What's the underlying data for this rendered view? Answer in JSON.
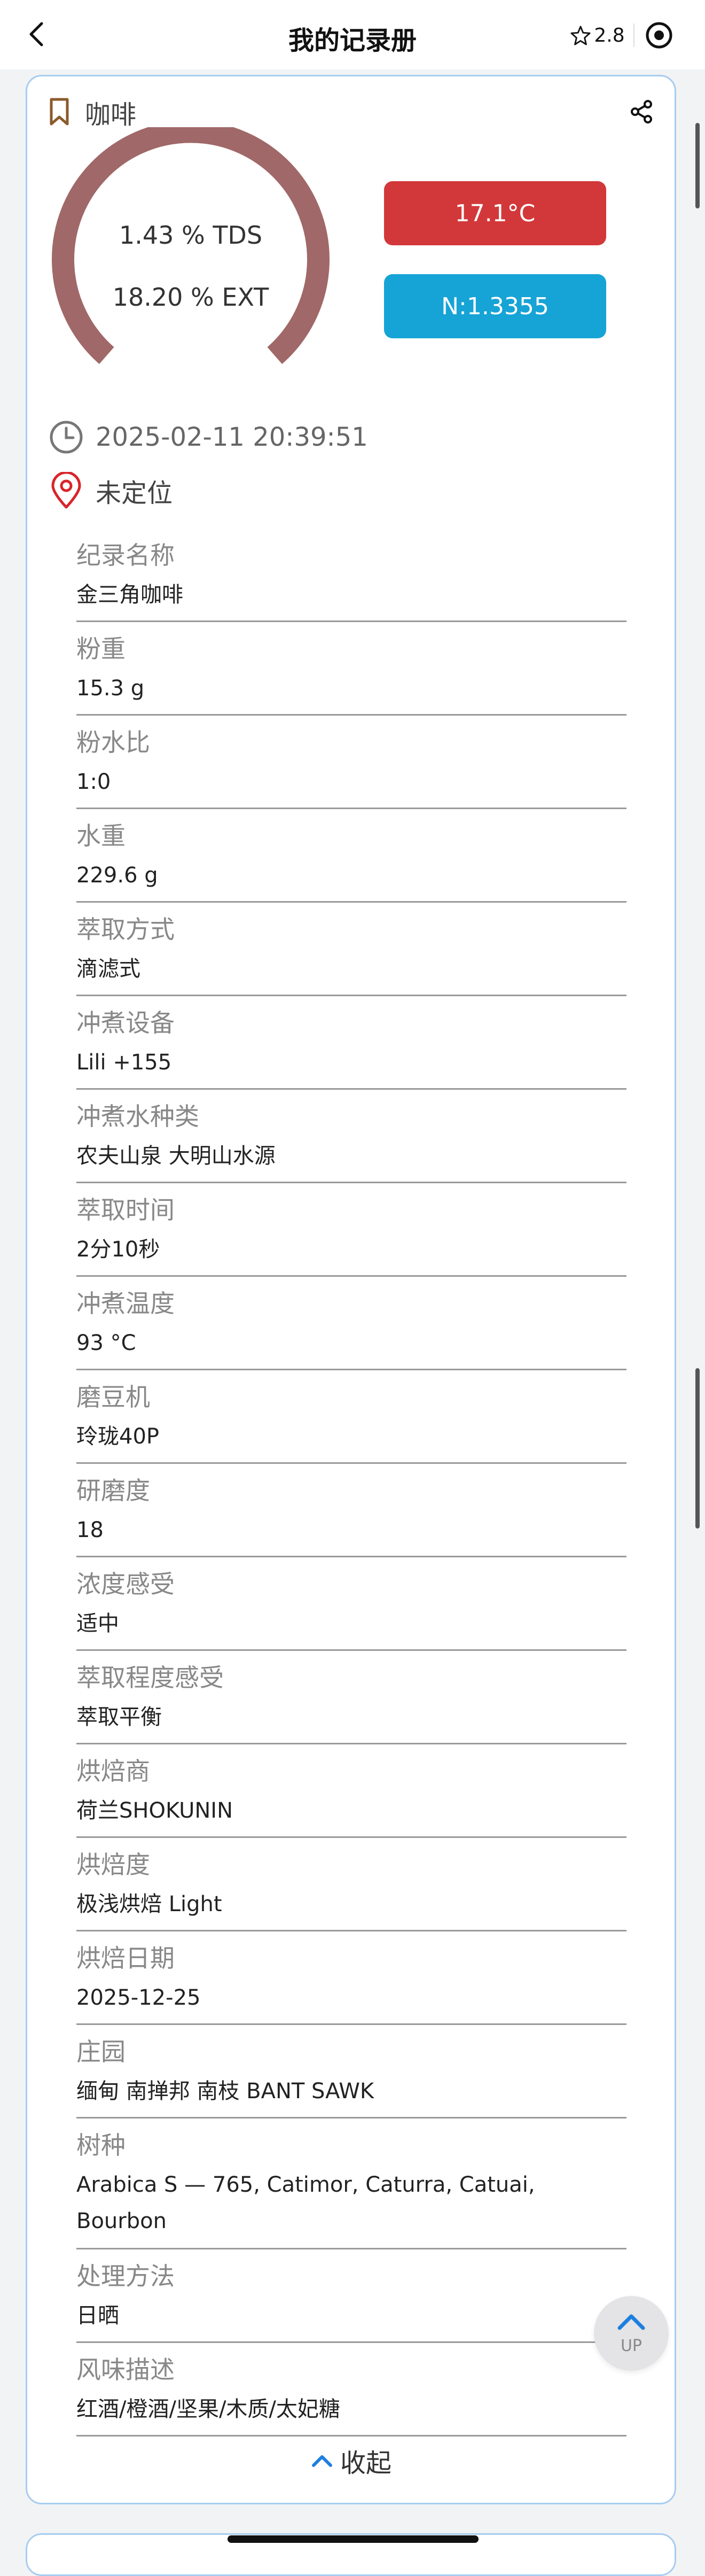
{
  "nav": {
    "title": "我的记录册",
    "rating": "2.8"
  },
  "colors": {
    "gauge": "#a06868",
    "temp_badge": "#d2383a",
    "nd_badge": "#16a3d6",
    "card_border": "#a7cdf0",
    "location_pin": "#d8242a"
  },
  "record": {
    "category": "咖啡",
    "tds": "1.43 % TDS",
    "ext": "18.20 % EXT",
    "temperature": "17.1°C",
    "nd": "N:1.3355",
    "timestamp": "2025-02-11 20:39:51",
    "location": "未定位",
    "fields": [
      {
        "label": "纪录名称",
        "value": "金三角咖啡"
      },
      {
        "label": "粉重",
        "value": "15.3 g"
      },
      {
        "label": "粉水比",
        "value": "1:0"
      },
      {
        "label": "水重",
        "value": "229.6 g"
      },
      {
        "label": "萃取方式",
        "value": "滴滤式"
      },
      {
        "label": "冲煮设备",
        "value": "Lili +155"
      },
      {
        "label": "冲煮水种类",
        "value": "农夫山泉 大明山水源"
      },
      {
        "label": "萃取时间",
        "value": "2分10秒"
      },
      {
        "label": "冲煮温度",
        "value": "93 °C"
      },
      {
        "label": "磨豆机",
        "value": "玲珑40P"
      },
      {
        "label": "研磨度",
        "value": "18"
      },
      {
        "label": "浓度感受",
        "value": "适中"
      },
      {
        "label": "萃取程度感受",
        "value": "萃取平衡"
      },
      {
        "label": "烘焙商",
        "value": "荷兰SHOKUNIN"
      },
      {
        "label": "烘焙度",
        "value": "极浅烘焙 Light"
      },
      {
        "label": "烘焙日期",
        "value": "2025-12-25"
      },
      {
        "label": "庄园",
        "value": "缅甸 南掸邦 南枝 BANT SAWK"
      },
      {
        "label": "树种",
        "value": "Arabica S — 765, Catimor, Caturra, Catuai, Bourbon"
      },
      {
        "label": "处理方法",
        "value": "日晒"
      },
      {
        "label": "风味描述",
        "value": "红酒/橙酒/坚果/木质/太妃糖"
      }
    ],
    "collapse_label": "收起",
    "up_label": "UP"
  }
}
